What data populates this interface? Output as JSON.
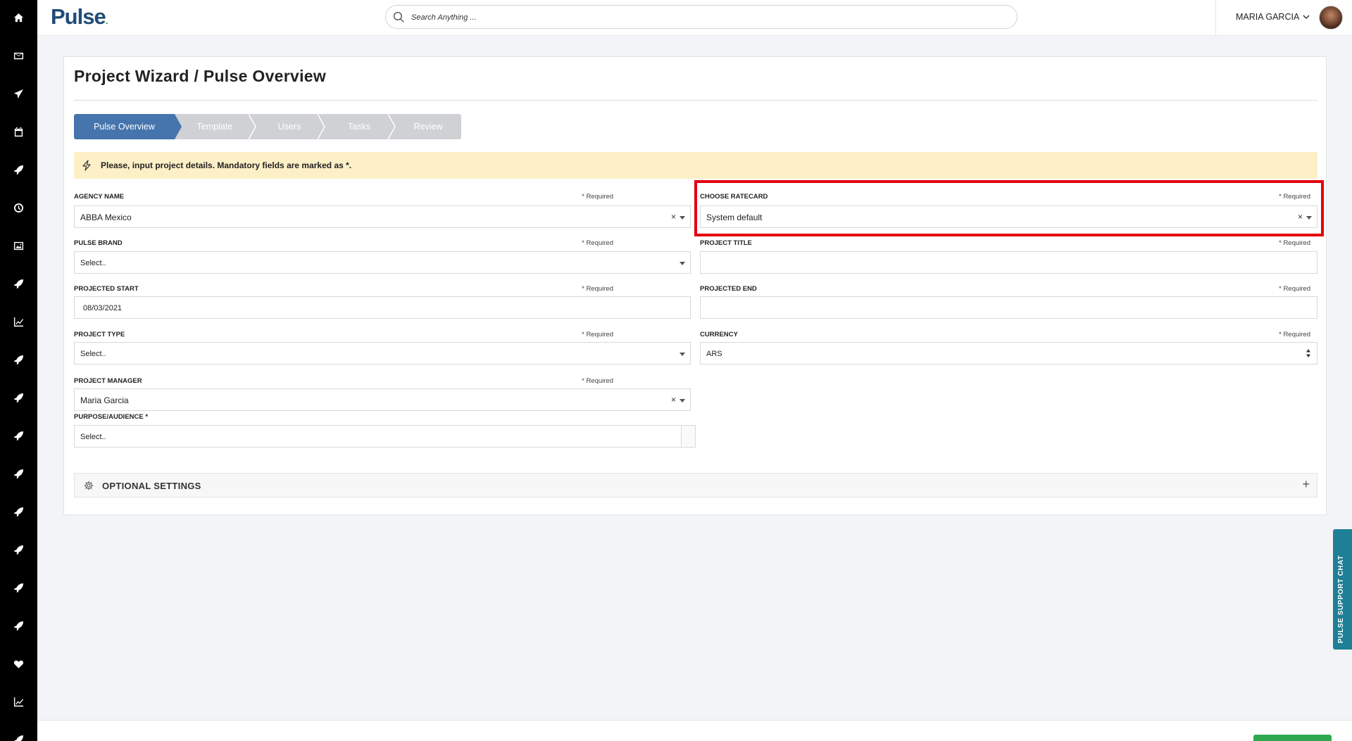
{
  "app": {
    "logo": "Pulse",
    "logo_dot": "."
  },
  "search": {
    "placeholder": "Search Anything ..."
  },
  "user": {
    "name": "MARIA GARCIA"
  },
  "page": {
    "title": "Project Wizard / Pulse Overview"
  },
  "steps": [
    {
      "label": "Pulse Overview",
      "active": true
    },
    {
      "label": "Template",
      "active": false
    },
    {
      "label": "Users",
      "active": false
    },
    {
      "label": "Tasks",
      "active": false
    },
    {
      "label": "Review",
      "active": false
    }
  ],
  "alert": {
    "text": "Please, input project details. Mandatory fields are marked as *."
  },
  "form": {
    "required": "* Required",
    "agency_name": {
      "label": "AGENCY NAME",
      "value": "ABBA Mexico"
    },
    "choose_ratecard": {
      "label": "CHOOSE RATECARD",
      "value": "System default"
    },
    "pulse_brand": {
      "label": "PULSE BRAND",
      "placeholder": "Select.."
    },
    "project_title": {
      "label": "PROJECT TITLE",
      "value": ""
    },
    "projected_start": {
      "label": "PROJECTED START",
      "value": "08/03/2021"
    },
    "projected_end": {
      "label": "PROJECTED END",
      "value": ""
    },
    "project_type": {
      "label": "PROJECT TYPE",
      "placeholder": "Select.."
    },
    "currency": {
      "label": "CURRENCY",
      "value": "ARS"
    },
    "project_manager": {
      "label": "PROJECT MANAGER",
      "value": "Maria Garcia"
    },
    "purpose_audience": {
      "label": "PURPOSE/AUDIENCE *",
      "placeholder": "Select.."
    },
    "clear_symbol": "×"
  },
  "optional_settings": {
    "label": "OPTIONAL SETTINGS",
    "toggle": "+"
  },
  "support_chat": {
    "label": "PULSE SUPPORT CHAT"
  },
  "sidebar": {
    "items": [
      "home-icon",
      "mail-icon",
      "send-icon",
      "calendar-icon",
      "rocket-icon",
      "clock-icon",
      "image-icon",
      "rocket-icon",
      "chart-line-icon",
      "rocket-icon",
      "rocket-icon",
      "rocket-icon",
      "rocket-icon",
      "rocket-icon",
      "rocket-icon",
      "rocket-icon",
      "rocket-icon",
      "heart-icon",
      "chart-line-icon",
      "rocket-icon"
    ]
  },
  "colors": {
    "accent": "#4674ad",
    "sidebar": "#000000",
    "alert_bg": "#fdf0c7",
    "highlight": "#e3000f",
    "chat": "#1e7f96",
    "brand_green": "#3fae49"
  }
}
